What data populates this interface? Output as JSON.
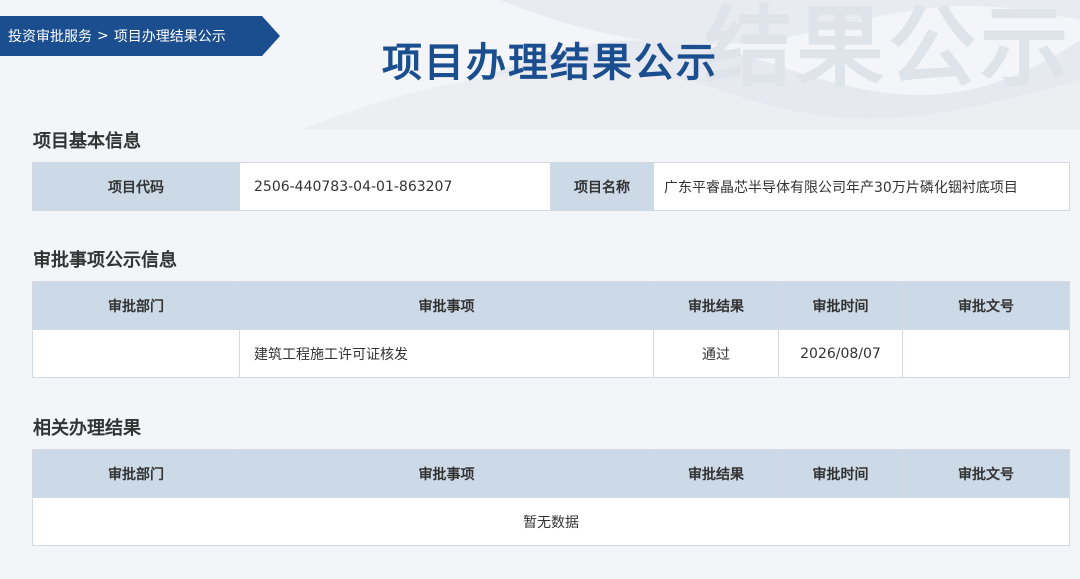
{
  "breadcrumb": {
    "root": "投资审批服务",
    "separator": ">",
    "current": "项目办理结果公示"
  },
  "page_title": "项目办理结果公示",
  "watermark": "结果公示",
  "basic_info": {
    "title": "项目基本信息",
    "code_label": "项目代码",
    "code_value": "2506-440783-04-01-863207",
    "name_label": "项目名称",
    "name_value": "广东平睿晶芯半导体有限公司年产30万片磷化铟衬底项目"
  },
  "approval_info": {
    "title": "审批事项公示信息",
    "columns": [
      "审批部门",
      "审批事项",
      "审批结果",
      "审批时间",
      "审批文号"
    ],
    "rows": [
      {
        "dept": "",
        "item": "建筑工程施工许可证核发",
        "result": "通过",
        "time": "2026/08/07",
        "doc_no": ""
      }
    ]
  },
  "related_results": {
    "title": "相关办理结果",
    "columns": [
      "审批部门",
      "审批事项",
      "审批结果",
      "审批时间",
      "审批文号"
    ],
    "empty_text": "暂无数据"
  }
}
